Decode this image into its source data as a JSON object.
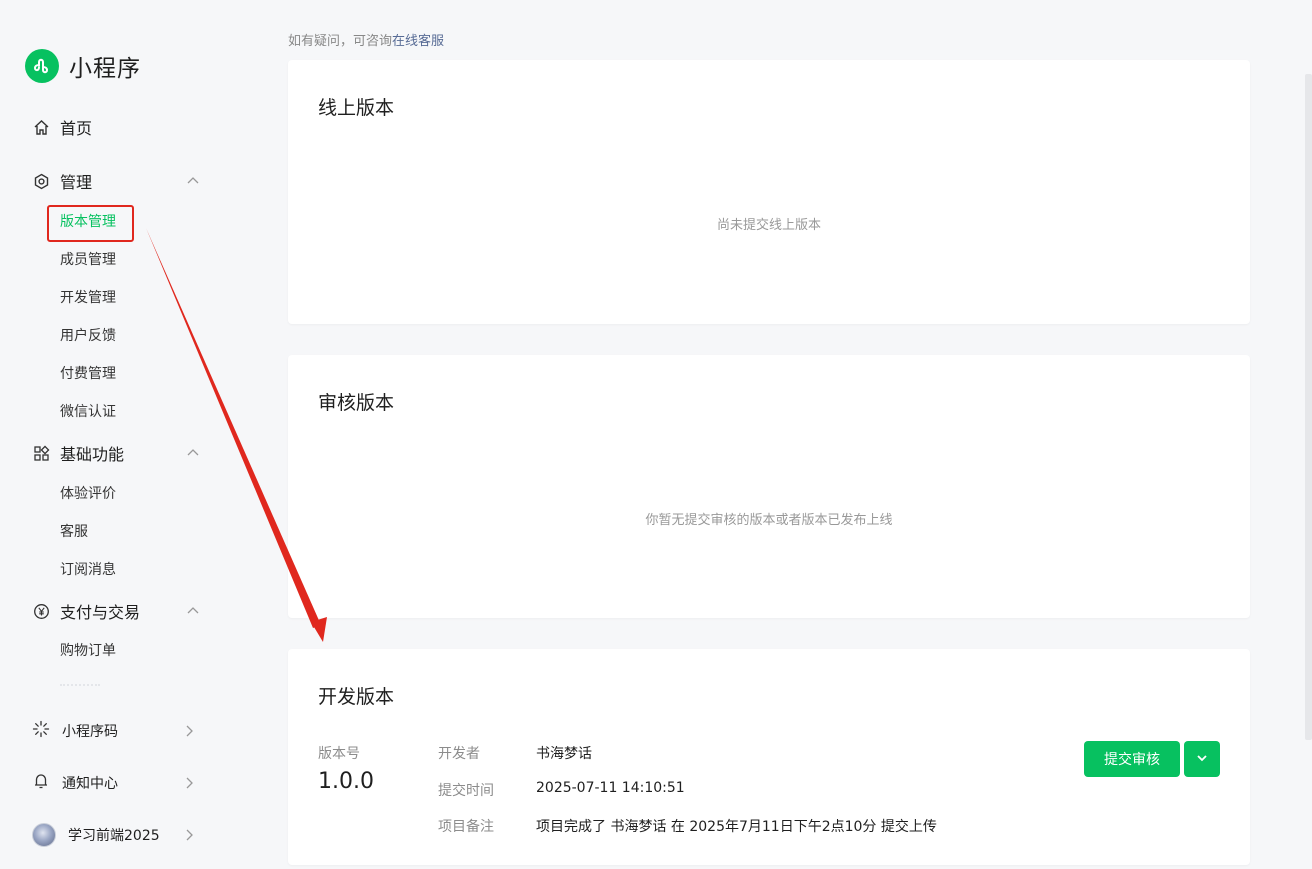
{
  "app": {
    "title": "小程序"
  },
  "nav": {
    "home": "首页",
    "manage": {
      "label": "管理",
      "items": [
        "版本管理",
        "成员管理",
        "开发管理",
        "用户反馈",
        "付费管理",
        "微信认证"
      ]
    },
    "basic": {
      "label": "基础功能",
      "items": [
        "体验评价",
        "客服",
        "订阅消息"
      ]
    },
    "pay": {
      "label": "支付与交易",
      "items": [
        "购物订单"
      ]
    },
    "bottom": {
      "qrcode": "小程序码",
      "notify": "通知中心",
      "user": "学习前端2025"
    }
  },
  "hint": {
    "text": "如有疑问，可咨询",
    "link": "在线客服"
  },
  "online": {
    "title": "线上版本",
    "empty": "尚未提交线上版本"
  },
  "review": {
    "title": "审核版本",
    "empty": "你暂无提交审核的版本或者版本已发布上线"
  },
  "dev": {
    "title": "开发版本",
    "version_label": "版本号",
    "version": "1.0.0",
    "developer_label": "开发者",
    "developer": "书海梦话",
    "time_label": "提交时间",
    "time": "2025-07-11 14:10:51",
    "note_label": "项目备注",
    "note": "项目完成了 书海梦话 在 2025年7月11日下午2点10分 提交上传",
    "submit_button": "提交审核"
  },
  "colors": {
    "brand": "#07c160",
    "link": "#576b95",
    "annotation": "#e0281e"
  }
}
